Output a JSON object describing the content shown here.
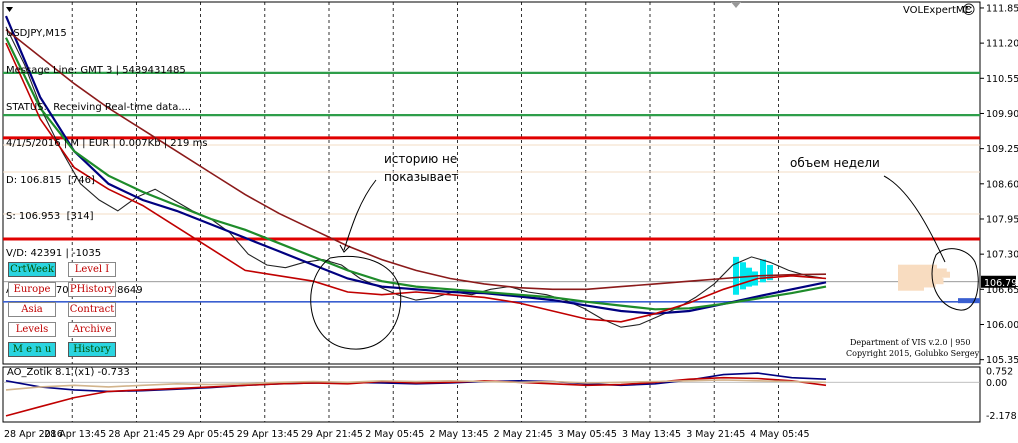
{
  "chart_data": {
    "type": "line",
    "symbol": "USDJPY",
    "timeframe": "M15",
    "title": "USDJPY,M15",
    "expert": "VOLExpertME",
    "info_lines": [
      "Message Line: GMT 3 | 5439431485",
      "STATUS:  Receiving Real-time data....",
      "4/1/5/2016 | M | EUR | 0.007Kb | 219 ms",
      "D: 106.815  [746]",
      "S: 106.953  [314]",
      "V/D: 42391 | -1035",
      "A/D: 157870 | A/W: 638649"
    ],
    "price_axis_ticks": [
      "111.85",
      "111.20",
      "110.55",
      "109.90",
      "109.25",
      "108.60",
      "107.95",
      "107.30",
      "106.65",
      "106.00",
      "105.35"
    ],
    "ylim": [
      105.27,
      111.96
    ],
    "current_price_label": "106.79",
    "horizontal_levels": [
      {
        "price": 110.65,
        "color": "#2e9e4a"
      },
      {
        "price": 109.87,
        "color": "#2e9e4a"
      },
      {
        "price": 109.45,
        "color": "#e00000"
      },
      {
        "price": 107.58,
        "color": "#e00000"
      },
      {
        "price": 106.42,
        "color": "#3a5fd0"
      }
    ],
    "x_ticks": [
      "28 Apr 2016",
      "28 Apr 13:45",
      "28 Apr 21:45",
      "29 Apr 05:45",
      "29 Apr 13:45",
      "29 Apr 21:45",
      "2 May 05:45",
      "2 May 13:45",
      "2 May 21:45",
      "3 May 05:45",
      "3 May 13:45",
      "3 May 21:45",
      "4 May 05:45"
    ],
    "price_series": [
      111.5,
      110.8,
      109.9,
      109.2,
      108.6,
      108.3,
      108.1,
      108.35,
      108.5,
      108.3,
      108.1,
      107.95,
      107.7,
      107.3,
      107.1,
      107.05,
      107.15,
      107.2,
      107.1,
      106.85,
      106.7,
      106.55,
      106.45,
      106.5,
      106.6,
      106.55,
      106.65,
      106.7,
      106.6,
      106.55,
      106.45,
      106.3,
      106.1,
      105.95,
      106.0,
      106.15,
      106.3,
      106.5,
      106.75,
      107.1,
      107.25,
      107.15,
      107.0,
      106.9,
      106.85
    ],
    "moving_averages": [
      {
        "color": "#000080",
        "values": [
          111.7,
          110.2,
          109.2,
          108.6,
          108.3,
          108.1,
          107.85,
          107.6,
          107.35,
          107.1,
          106.85,
          106.7,
          106.65,
          106.6,
          106.58,
          106.52,
          106.45,
          106.35,
          106.25,
          106.2,
          106.25,
          106.38,
          106.52,
          106.65,
          106.78
        ]
      },
      {
        "color": "#1e8c2a",
        "values": [
          111.3,
          110.0,
          109.2,
          108.75,
          108.45,
          108.2,
          107.95,
          107.75,
          107.5,
          107.25,
          107.0,
          106.8,
          106.7,
          106.65,
          106.6,
          106.55,
          106.5,
          106.42,
          106.35,
          106.28,
          106.3,
          106.38,
          106.48,
          106.58,
          106.7
        ]
      },
      {
        "color": "#8b1a1a",
        "values": [
          111.45,
          110.95,
          110.45,
          110.0,
          109.6,
          109.2,
          108.8,
          108.4,
          108.05,
          107.75,
          107.45,
          107.2,
          107.0,
          106.85,
          106.75,
          106.68,
          106.65,
          106.65,
          106.7,
          106.75,
          106.8,
          106.85,
          106.9,
          106.92,
          106.93
        ]
      },
      {
        "color": "#c00000",
        "values": [
          111.2,
          109.8,
          108.9,
          108.5,
          108.2,
          107.8,
          107.4,
          107.0,
          106.9,
          106.8,
          106.6,
          106.55,
          106.6,
          106.55,
          106.5,
          106.4,
          106.25,
          106.1,
          106.05,
          106.2,
          106.4,
          106.65,
          106.85,
          106.9,
          106.85
        ]
      }
    ],
    "annotations": [
      "историю не",
      "показывает",
      "объем недели"
    ],
    "buttons": [
      {
        "label": "CrtWeek",
        "active": true
      },
      {
        "label": "Level I",
        "active": false
      },
      {
        "label": "Europe",
        "active": false
      },
      {
        "label": "PHistory",
        "active": false
      },
      {
        "label": "Asia",
        "active": false
      },
      {
        "label": "Contract",
        "active": false
      },
      {
        "label": "Levels",
        "active": false
      },
      {
        "label": "Archive",
        "active": false
      },
      {
        "label": "M e n u",
        "active": true
      },
      {
        "label": "History",
        "active": true
      }
    ],
    "footer_lines": [
      "Department of VIS  v.2.0 | 950",
      "Copyright 2015, Golubko Sergey"
    ],
    "oscillator": {
      "title": "AO_Zotik 8.1 (x1) -0.733",
      "ticks": [
        "0.752",
        "0.00",
        "-2.178"
      ],
      "ylim": [
        -2.6,
        1.0
      ],
      "series": [
        {
          "color": "#000080",
          "values": [
            0.1,
            -0.3,
            -0.5,
            -0.6,
            -0.55,
            -0.45,
            -0.35,
            -0.2,
            -0.1,
            -0.05,
            0.0,
            -0.05,
            -0.1,
            -0.05,
            0.05,
            0.1,
            0.05,
            -0.1,
            -0.2,
            -0.1,
            0.15,
            0.5,
            0.6,
            0.3,
            0.2
          ]
        },
        {
          "color": "#c00000",
          "values": [
            -2.2,
            -1.6,
            -1.0,
            -0.6,
            -0.5,
            -0.4,
            -0.3,
            -0.2,
            -0.1,
            -0.05,
            -0.1,
            0.05,
            -0.05,
            0.0,
            0.1,
            0.0,
            -0.1,
            -0.2,
            -0.15,
            0.0,
            0.2,
            0.3,
            0.25,
            0.1,
            -0.2
          ]
        },
        {
          "color": "#d2b48c",
          "values": [
            -0.5,
            -0.3,
            -0.2,
            -0.3,
            -0.2,
            -0.1,
            -0.15,
            -0.1,
            0.0,
            0.05,
            0.0,
            0.1,
            0.05,
            0.1,
            0.05,
            0.0,
            0.05,
            -0.05,
            0.0,
            0.05,
            0.1,
            0.15,
            0.1,
            0.05,
            0.0
          ]
        }
      ]
    },
    "colors": {
      "bull_volume": "#00e8f0",
      "volume_profile": "#f8dcc0",
      "profile_extra": "#3a5fd0"
    }
  }
}
